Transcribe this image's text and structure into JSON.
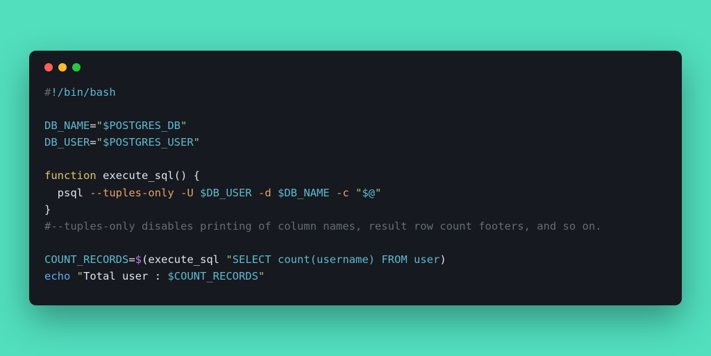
{
  "code": {
    "line1": {
      "shebang_hash": "#",
      "shebang_rest": "!/bin/bash"
    },
    "line3": {
      "var": "DB_NAME",
      "eq": "=",
      "q1": "\"",
      "val": "$POSTGRES_DB",
      "q2": "\""
    },
    "line4": {
      "var": "DB_USER",
      "eq": "=",
      "q1": "\"",
      "val": "$POSTGRES_USER",
      "q2": "\""
    },
    "line6": {
      "kw": "function",
      "name": " execute_sql",
      "rest": "() {"
    },
    "line7": {
      "indent": "  ",
      "cmd": "psql",
      "opt1": " --tuples-only",
      "opt2": " -U",
      "var1": " $DB_USER",
      "opt3": " -d",
      "var2": " $DB_NAME",
      "opt4": " -c",
      "q1": " \"",
      "arg": "$@",
      "q2": "\""
    },
    "line8": {
      "brace": "}"
    },
    "line9": {
      "comment": "#--tuples-only disables printing of column names, result row count footers, and so on."
    },
    "line11": {
      "var": "COUNT_RECORDS",
      "eq": "=",
      "dollar": "$",
      "lparen": "(",
      "fn": "execute_sql ",
      "q": "\"",
      "sql": "SELECT count(username) FROM user",
      "rparen": ")"
    },
    "line12": {
      "cmd": "echo",
      "q1": " \"",
      "txt": "Total user : ",
      "var": "$COUNT_RECORDS",
      "q2": "\""
    }
  }
}
